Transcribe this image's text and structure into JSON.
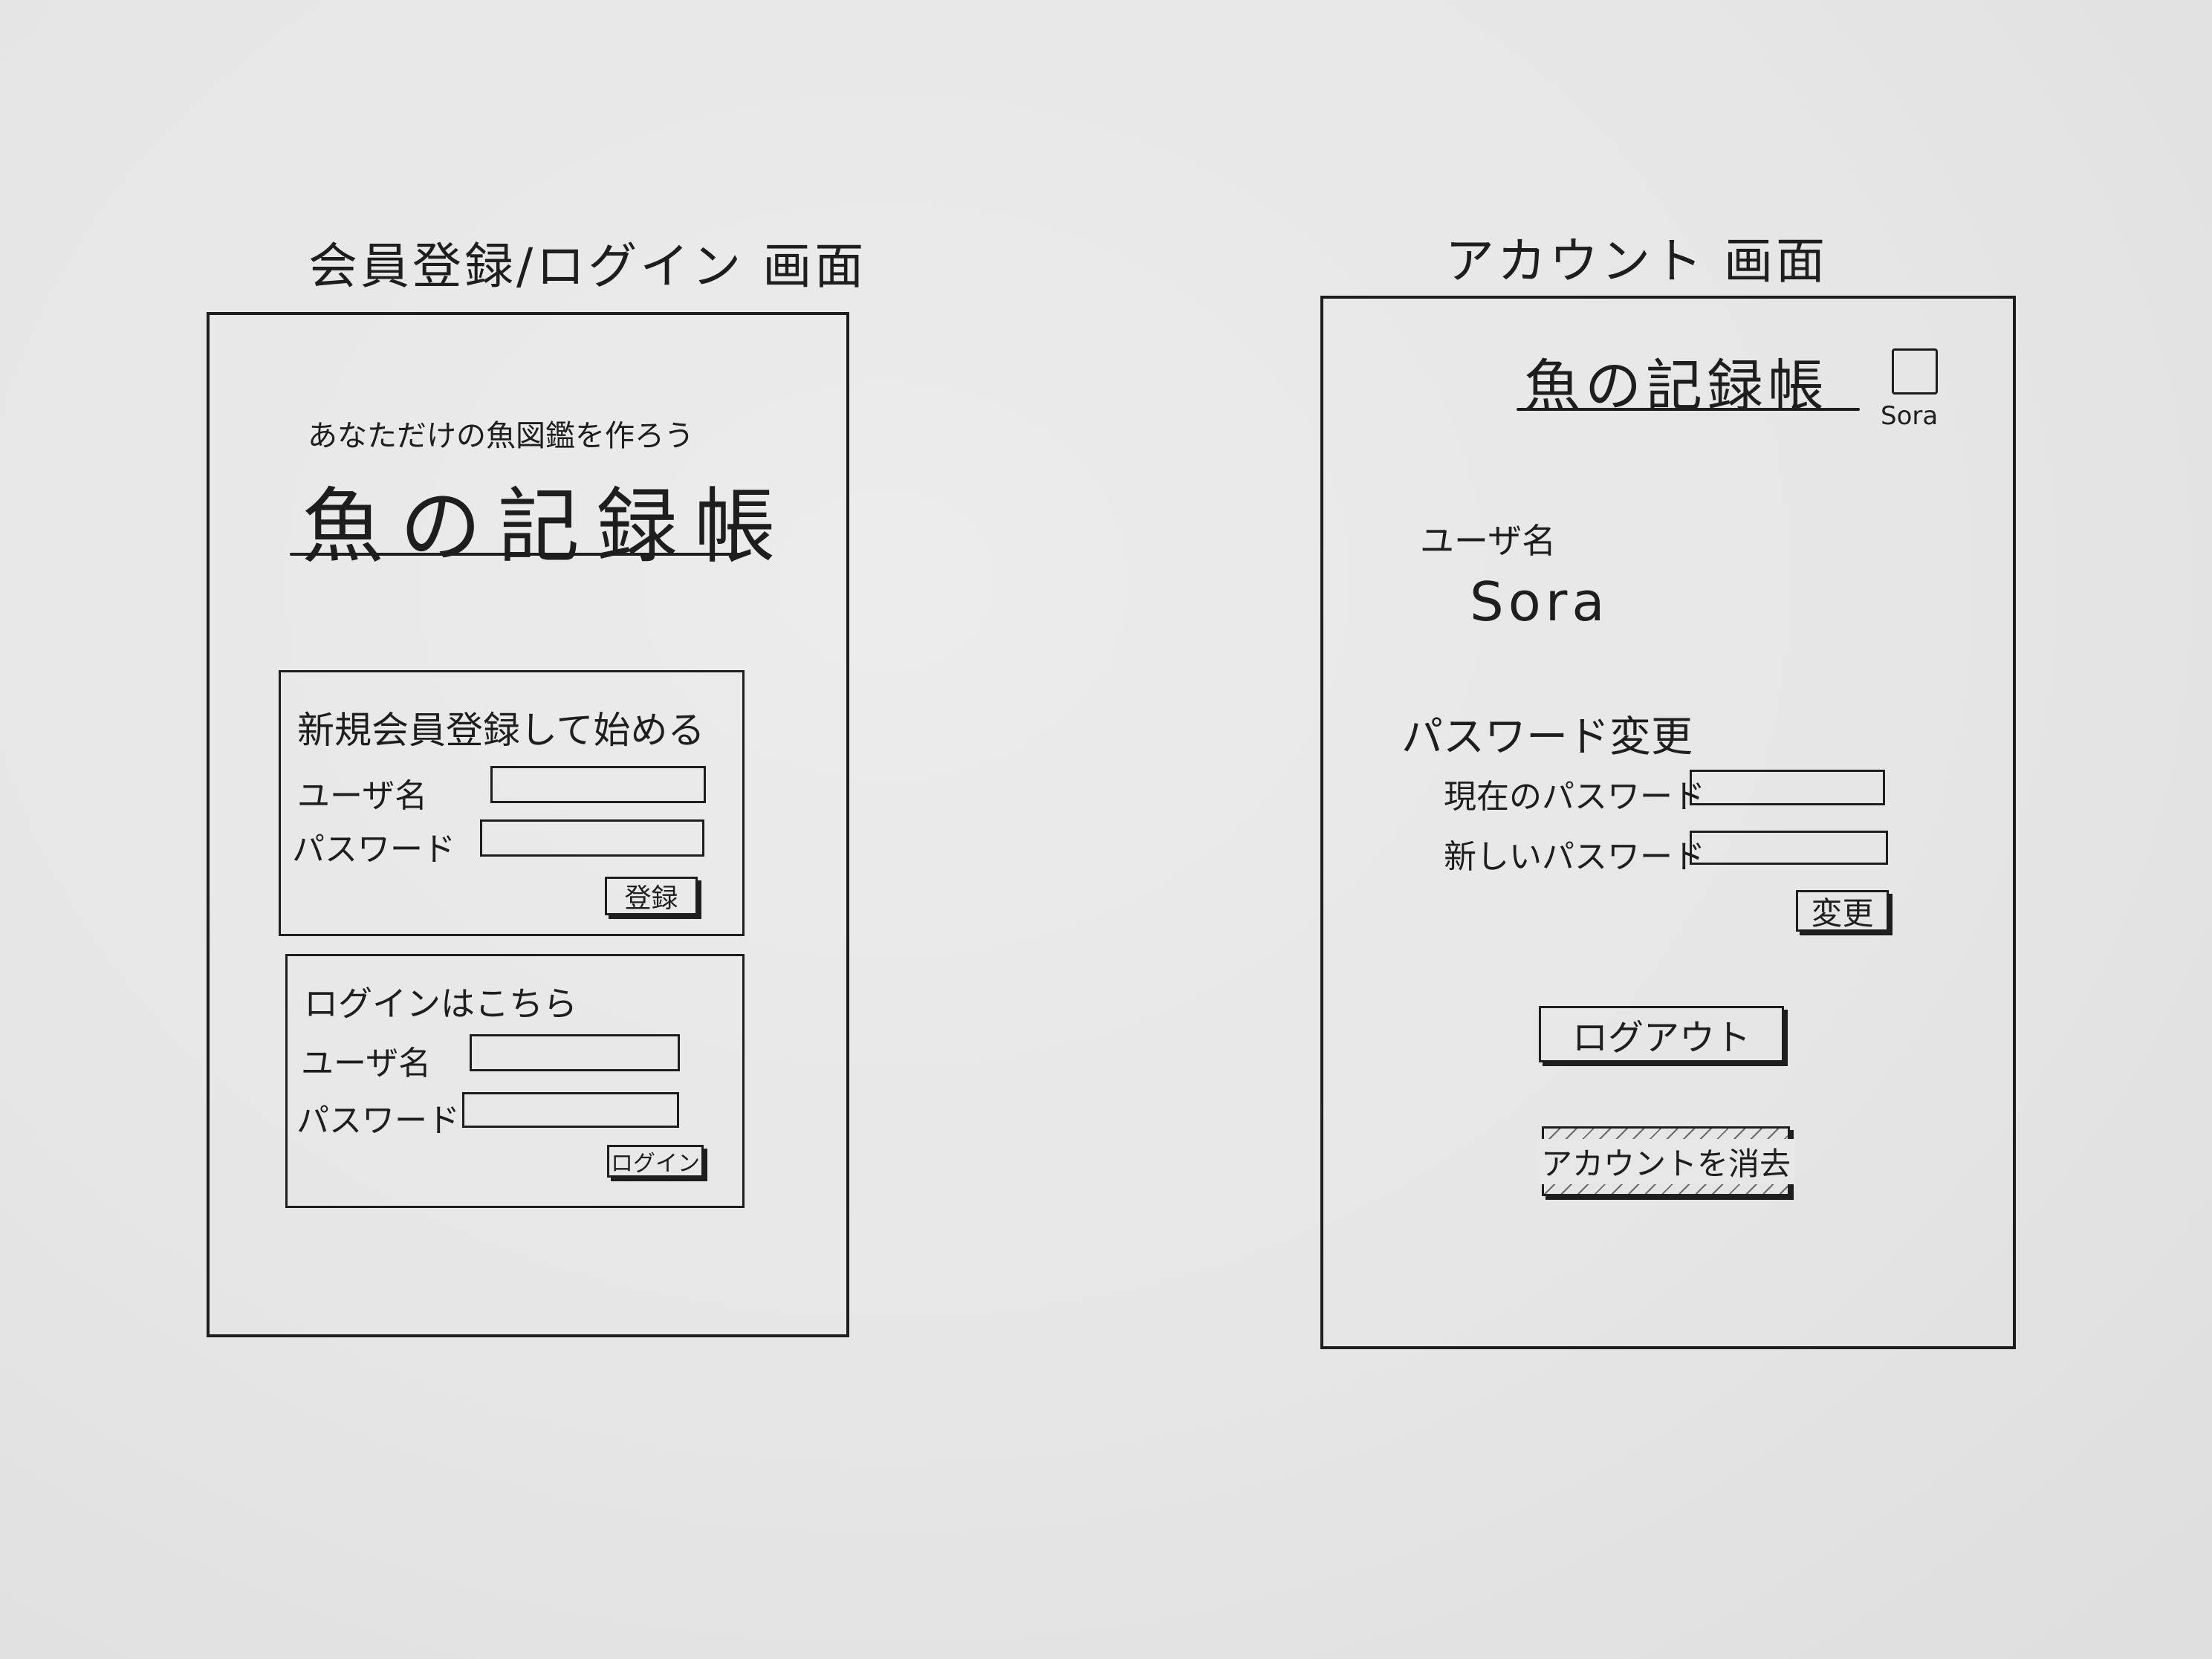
{
  "screens": {
    "register_login": {
      "title": "会員登録/ログイン 画面",
      "tagline": "あなただけの魚図鑑を作ろう",
      "app_name": "魚の記録帳",
      "register": {
        "heading": "新規会員登録して始める",
        "username_label": "ユーザ名",
        "password_label": "パスワード",
        "username_value": "",
        "password_value": "",
        "submit_label": "登録"
      },
      "login": {
        "heading": "ログインはこちら",
        "username_label": "ユーザ名",
        "password_label": "パスワード",
        "username_value": "",
        "password_value": "",
        "submit_label": "ログイン"
      }
    },
    "account": {
      "title": "アカウント 画面",
      "app_name": "魚の記録帳",
      "avatar_caption": "Sora",
      "username_label": "ユーザ名",
      "username_value": "Sora",
      "password_change": {
        "heading": "パスワード変更",
        "current_label": "現在のパスワード",
        "new_label": "新しいパスワード",
        "current_value": "",
        "new_value": "",
        "submit_label": "変更"
      },
      "logout_label": "ログアウト",
      "delete_label": "アカウントを消去"
    }
  }
}
